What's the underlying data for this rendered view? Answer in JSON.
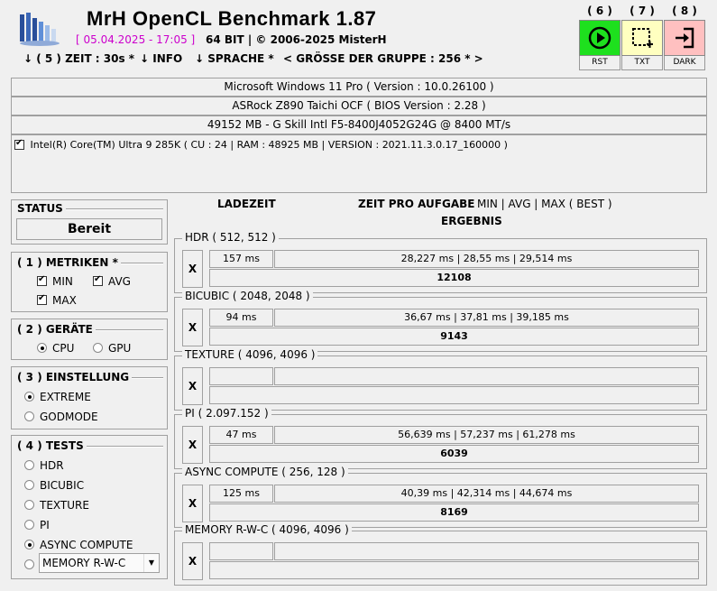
{
  "header": {
    "title": "MrH OpenCL Benchmark 1.87",
    "date": "[ 05.04.2025 - 17:05 ]",
    "bits_copyright": "64 BIT | ©  2006-2025 MisterH"
  },
  "menu": {
    "zeit": "↓ ( 5 ) ZEIT : 30s *",
    "info": "↓ INFO",
    "sprache": "↓ SPRACHE *",
    "gruppe": "< GRÖSSE DER GRUPPE : 256 * >"
  },
  "toolbar": [
    {
      "num": "( 6 )",
      "label": "RST",
      "color": "#1ee01e"
    },
    {
      "num": "( 7 )",
      "label": "TXT",
      "color": "#ffffc0"
    },
    {
      "num": "( 8 )",
      "label": "DARK",
      "color": "#ffc0c0"
    }
  ],
  "system": {
    "os": "Microsoft Windows 11 Pro ( Version : 10.0.26100 )",
    "board": "ASRock Z890 Taichi OCF ( BIOS Version : 2.28 )",
    "memory": "49152 MB - G Skill Intl F5-8400J4052G24G     @ 8400 MT/s",
    "cpu": "Intel(R) Core(TM) Ultra 9 285K ( CU : 24 | RAM : 48925 MB | VERSION : 2021.11.3.0.17_160000 )"
  },
  "status": {
    "title": "STATUS",
    "value": "Bereit"
  },
  "metrics": {
    "title": "( 1 ) METRIKEN *",
    "min": "MIN",
    "avg": "AVG",
    "max": "MAX"
  },
  "devices": {
    "title": "( 2 ) GERÄTE",
    "cpu": "CPU",
    "gpu": "GPU"
  },
  "settings": {
    "title": "( 3 ) EINSTELLUNG",
    "extreme": "EXTREME",
    "godmode": "GODMODE"
  },
  "tests": {
    "title": "( 4 ) TESTS",
    "items": [
      "HDR",
      "BICUBIC",
      "TEXTURE",
      "PI",
      "ASYNC COMPUTE"
    ],
    "dropdown": "MEMORY R-W-C"
  },
  "columns": {
    "ladezeit": "LADEZEIT",
    "zeit": "ZEIT PRO AUFGABE",
    "minavgmax": "MIN | AVG | MAX ( BEST )",
    "ergebnis": "ERGEBNIS"
  },
  "results": [
    {
      "name": "HDR ( 512, 512 )",
      "x": "X",
      "load": "157 ms",
      "times": "28,227 ms | 28,55 ms | 29,514 ms",
      "score": "12108"
    },
    {
      "name": "BICUBIC ( 2048, 2048 )",
      "x": "X",
      "load": "94 ms",
      "times": "36,67 ms | 37,81 ms | 39,185 ms",
      "score": "9143"
    },
    {
      "name": "TEXTURE ( 4096, 4096 )",
      "x": "X",
      "load": "",
      "times": "",
      "score": ""
    },
    {
      "name": "PI ( 2.097.152 )",
      "x": "X",
      "load": "47 ms",
      "times": "56,639 ms | 57,237 ms | 61,278 ms",
      "score": "6039"
    },
    {
      "name": "ASYNC COMPUTE ( 256, 128 )",
      "x": "X",
      "load": "125 ms",
      "times": "40,39 ms | 42,314 ms | 44,674 ms",
      "score": "8169"
    },
    {
      "name": "MEMORY R-W-C ( 4096, 4096 )",
      "x": "X",
      "load": "",
      "times": "",
      "score": ""
    }
  ]
}
